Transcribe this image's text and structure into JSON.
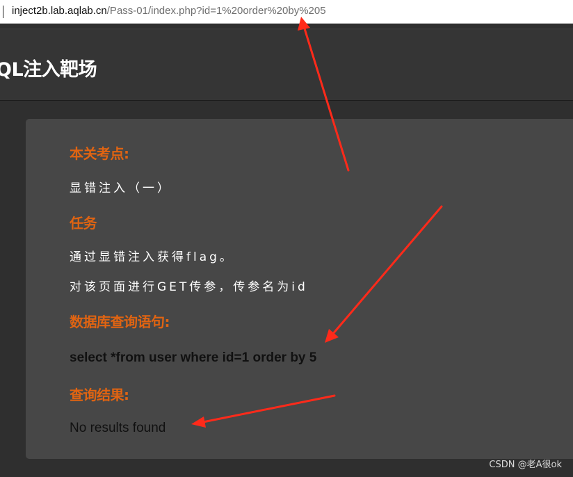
{
  "address_bar": {
    "host": "inject2b.lab.aqlab.cn",
    "path": "/Pass-01/index.php?id=1%20order%20by%205"
  },
  "header": {
    "title": "QL注入靶场"
  },
  "content": {
    "focus_heading": "本关考点:",
    "focus_text": "显错注入（一）",
    "task_heading": "任务",
    "task_line1": "通过显错注入获得flag。",
    "task_line2": "对该页面进行GET传参，传参名为id",
    "query_heading": "数据库查询语句:",
    "query_text": "select *from user where id=1 order by 5",
    "result_heading": "查询结果:",
    "result_text": "No results found"
  },
  "watermark": "CSDN @老A很ok",
  "colors": {
    "heading": "#e06412",
    "panel": "#474747",
    "background": "#2f2f2f",
    "annotation_arrow": "#ff2a1a"
  },
  "icons": {
    "annotation": "red-arrow-icon"
  }
}
